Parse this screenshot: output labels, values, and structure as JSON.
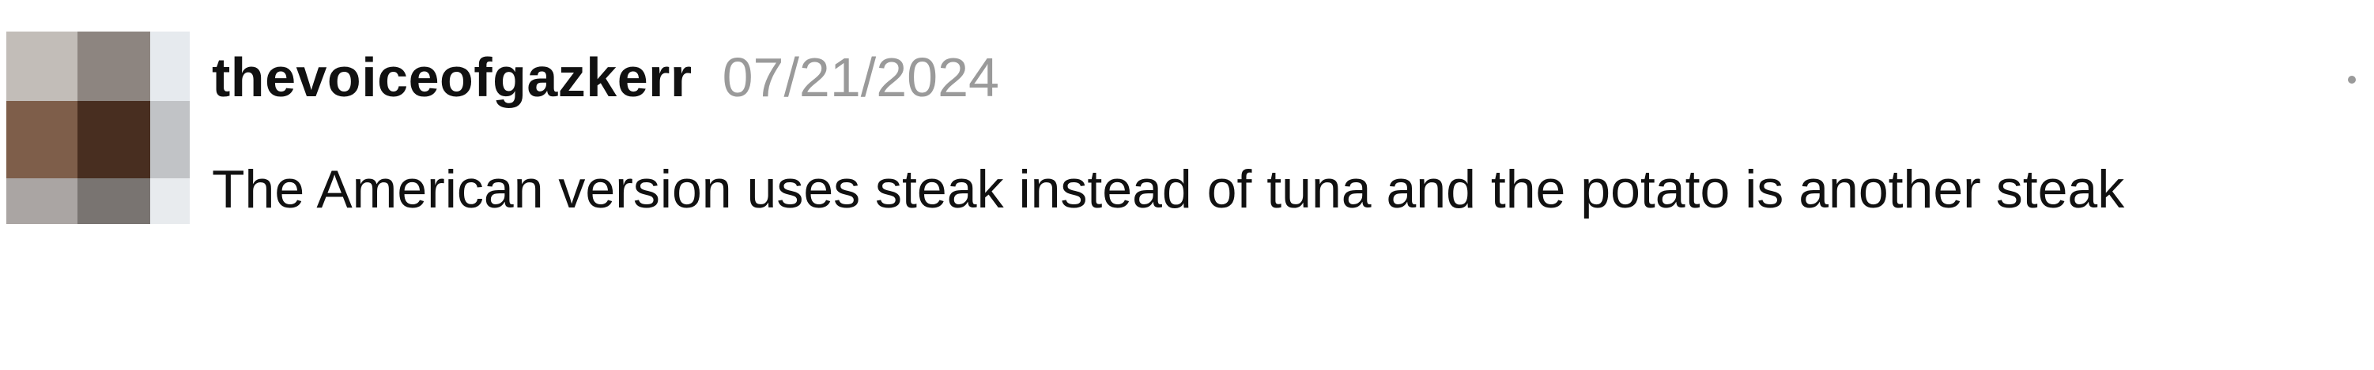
{
  "comment": {
    "username": "thevoiceofgazkerr",
    "date": "07/21/2024",
    "text": "The American version uses steak instead of tuna and the potato is another steak",
    "avatar_icon": "pixelated-avatar",
    "menu_icon": "more-options-icon"
  },
  "colors": {
    "username": "#111111",
    "date": "#9a9a9a",
    "text": "#111111",
    "background": "#ffffff"
  }
}
